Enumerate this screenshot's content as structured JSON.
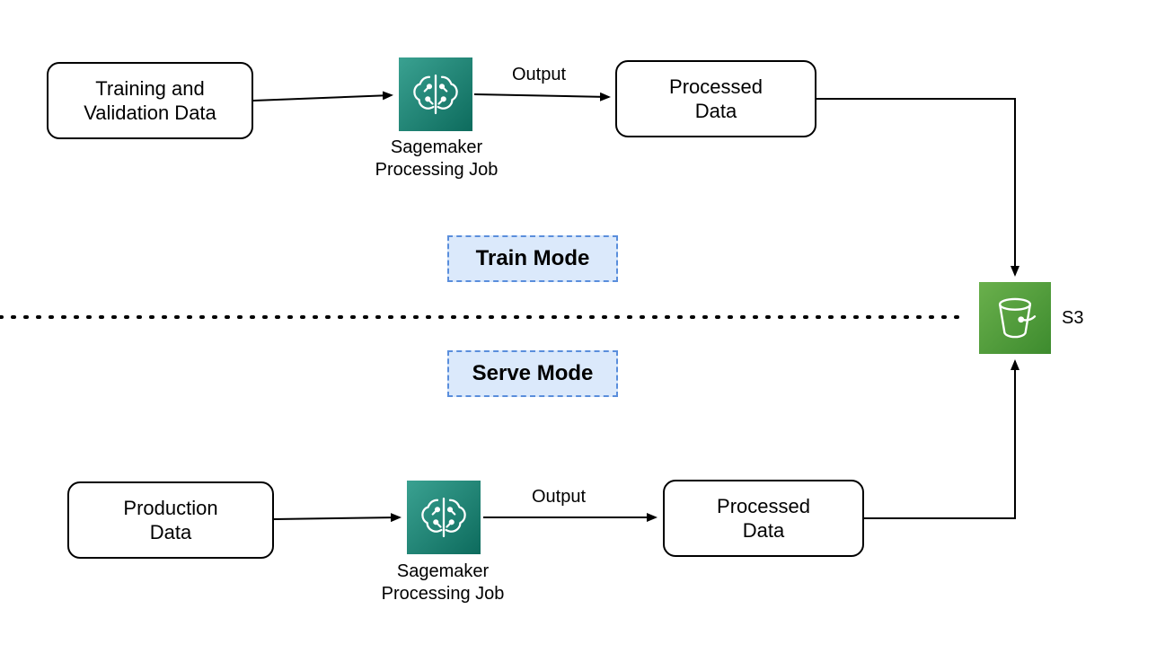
{
  "train": {
    "input_box": "Training and\nValidation Data",
    "processing_caption": "Sagemaker\nProcessing Job",
    "output_label": "Output",
    "processed_box": "Processed\nData",
    "mode_label": "Train Mode"
  },
  "serve": {
    "input_box": "Production\nData",
    "processing_caption": "Sagemaker\nProcessing Job",
    "output_label": "Output",
    "processed_box": "Processed\nData",
    "mode_label": "Serve Mode"
  },
  "storage": {
    "s3_label": "S3"
  },
  "icons": {
    "sagemaker": "sagemaker-icon",
    "s3_bucket": "s3-bucket-icon"
  }
}
